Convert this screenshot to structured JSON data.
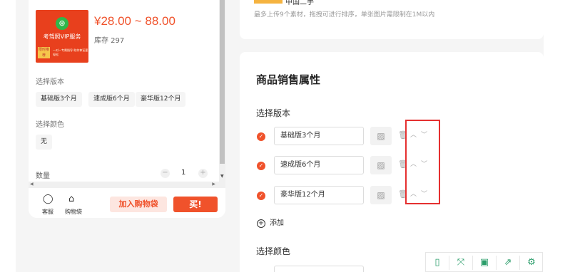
{
  "preview": {
    "product_image": {
      "vip_text": "考驾照VIP服务",
      "tag_text": "限时推荐",
      "small_text": "一对一专属指导 助你拿证更轻松"
    },
    "price": "¥28.00 ~ 88.00",
    "stock": "库存 297",
    "version_label": "选择版本",
    "versions": [
      "基础版3个月",
      "速成版6个月",
      "豪华版12个月"
    ],
    "color_label": "选择颜色",
    "colors": [
      "无"
    ],
    "quantity_label": "数量",
    "quantity_value": "1",
    "footer": {
      "service_label": "客服",
      "bag_label": "购物袋",
      "add_cart": "加入购物袋",
      "buy": "买!"
    }
  },
  "upload": {
    "cut_text": "中国二手",
    "hint": "最多上传9个素材，拖拽可进行排序，单张图片需限制在1M以内"
  },
  "sales_attributes": {
    "title": "商品销售属性",
    "version_label": "选择版本",
    "rows": [
      {
        "value": "基础版3个月"
      },
      {
        "value": "速成版6个月"
      },
      {
        "value": "豪华版12个月"
      }
    ],
    "add_label": "添加",
    "color_label": "选择颜色"
  },
  "accent_color": "#f0522b",
  "highlight_color": "#e53030",
  "toolbar": {
    "icons": [
      "phone-preview-icon",
      "fullscreen-icon",
      "save-icon",
      "share-icon",
      "settings-icon"
    ]
  }
}
